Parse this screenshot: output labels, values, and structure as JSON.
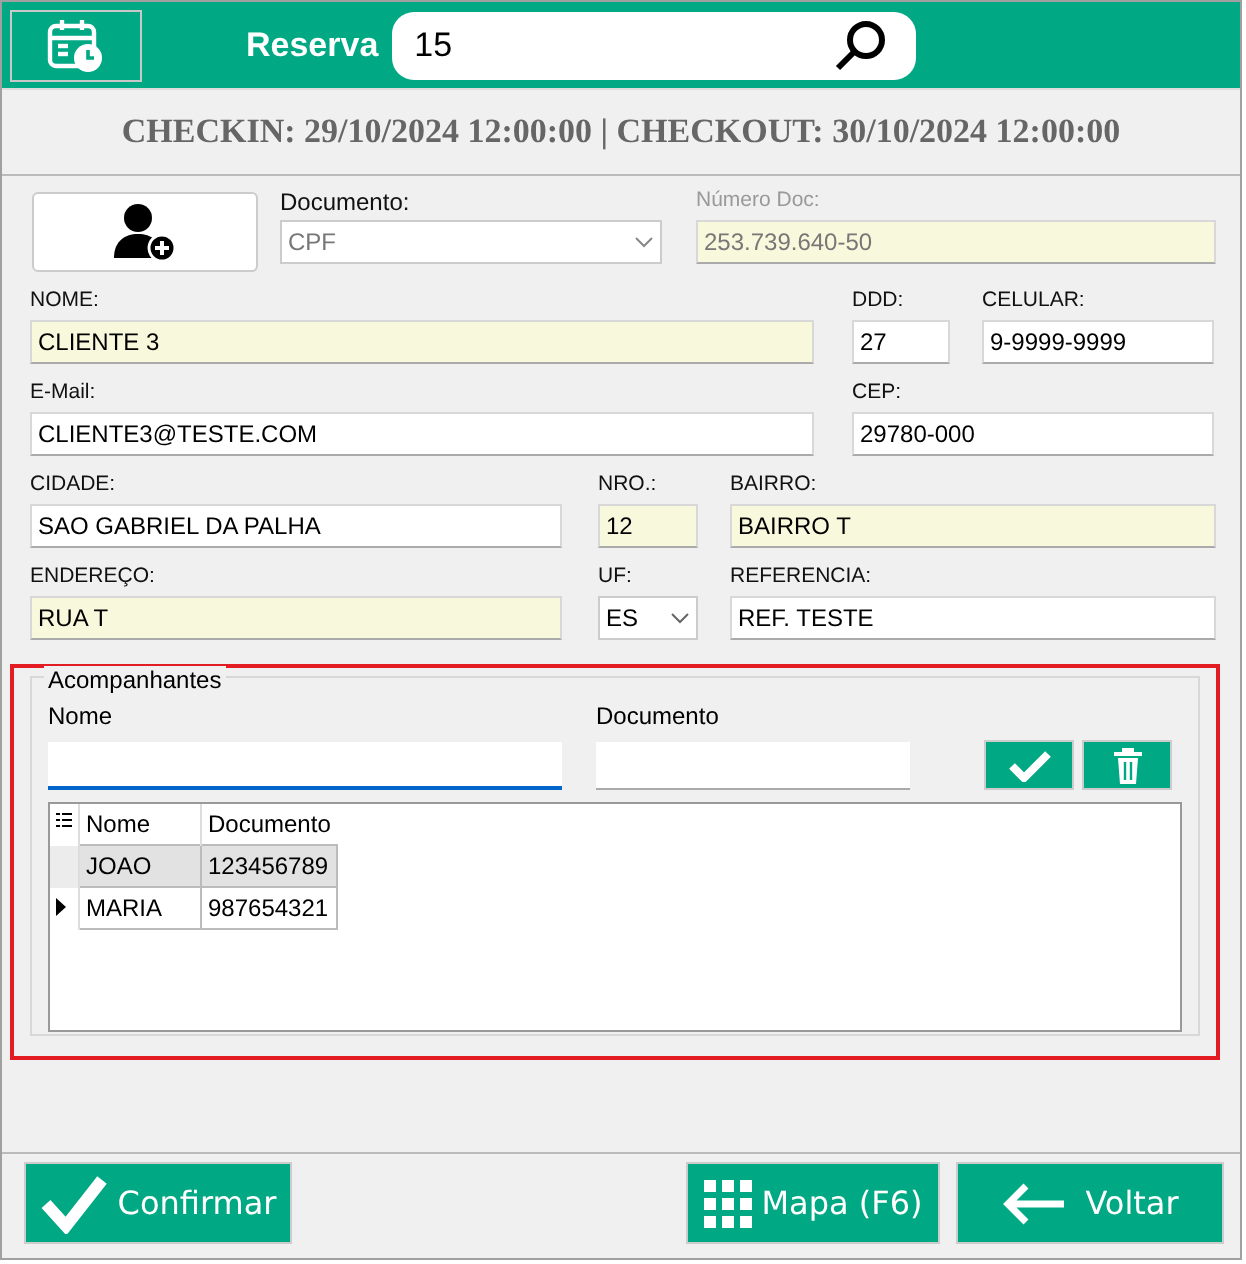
{
  "header": {
    "label": "Reserva",
    "search_value": "15"
  },
  "period": "CHECKIN: 29/10/2024 12:00:00 | CHECKOUT: 30/10/2024 12:00:00",
  "document": {
    "label": "Documento:",
    "value": "CPF",
    "disabled": true
  },
  "document_number": {
    "label": "Número Doc:",
    "value": "253.739.640-50",
    "disabled": true,
    "highlighted": true
  },
  "form_rows": [
    [
      {
        "label": "NOME:",
        "value": "CLIENTE 3",
        "kind": "text",
        "highlighted": true
      },
      {
        "label": "DDD:",
        "value": "27",
        "kind": "text",
        "highlighted": false
      },
      {
        "label": "CELULAR:",
        "value": "9-9999-9999",
        "kind": "text",
        "highlighted": false
      }
    ],
    [
      {
        "label": "E-Mail:",
        "value": "CLIENTE3@TESTE.COM",
        "kind": "text",
        "highlighted": false
      },
      {
        "label": "CEP:",
        "value": "29780-000",
        "kind": "text",
        "highlighted": false
      }
    ],
    [
      {
        "label": "CIDADE:",
        "value": "SAO GABRIEL DA PALHA",
        "kind": "text",
        "highlighted": false
      },
      {
        "label": "NRO.:",
        "value": "12",
        "kind": "text",
        "highlighted": true
      },
      {
        "label": "BAIRRO:",
        "value": "BAIRRO T",
        "kind": "text",
        "highlighted": true
      }
    ],
    [
      {
        "label": "ENDEREÇO:",
        "value": "RUA T",
        "kind": "text",
        "highlighted": true
      },
      {
        "label": "UF:",
        "value": "ES",
        "kind": "select",
        "highlighted": false
      },
      {
        "label": "REFERENCIA:",
        "value": "REF. TESTE",
        "kind": "text",
        "highlighted": false
      }
    ]
  ],
  "companions": {
    "title": "Acompanhantes",
    "name_label": "Nome",
    "document_label": "Documento",
    "columns": [
      "Nome",
      "Documento"
    ],
    "rows": [
      {
        "cells": [
          "JOAO",
          "123456789"
        ],
        "selected": false,
        "shaded": true
      },
      {
        "cells": [
          "MARIA",
          "987654321"
        ],
        "selected": true,
        "shaded": false
      }
    ]
  },
  "buttons": [
    {
      "label": "Confirmar",
      "kind": "confirm"
    },
    {
      "label": "Mapa (F6)",
      "kind": "map"
    },
    {
      "label": "Voltar",
      "kind": "back"
    }
  ]
}
